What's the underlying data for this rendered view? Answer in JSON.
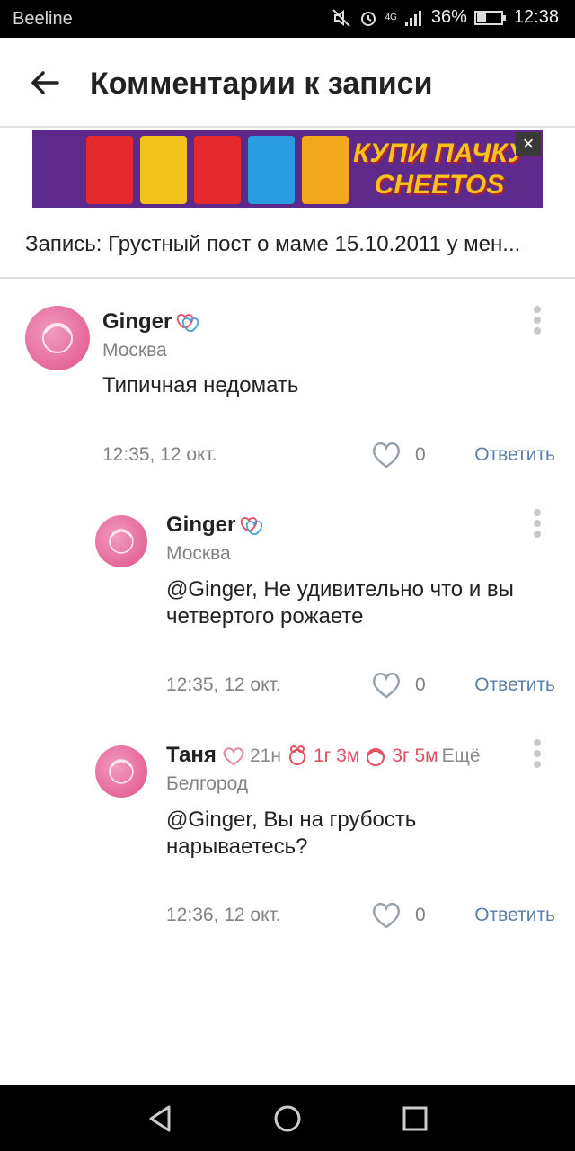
{
  "status": {
    "carrier": "Beeline",
    "network": "4G",
    "battery": "36%",
    "time": "12:38"
  },
  "header": {
    "title": "Комментарии к записи"
  },
  "ad": {
    "text_line1": "КУПИ ПАЧКУ",
    "text_line2": "CHEETOS",
    "close_label": "×"
  },
  "post": {
    "title": "Запись: Грустный пост о маме 15.10.2011 у мен..."
  },
  "comments": [
    {
      "name": "Ginger",
      "city": "Москва",
      "text": "Типичная недомать",
      "time": "12:35, 12 окт.",
      "likes": "0",
      "reply": "Ответить"
    },
    {
      "name": "Ginger",
      "city": "Москва",
      "text": "@Ginger, Не удивительно что и вы четвертого рожаете",
      "time": "12:35, 12 окт.",
      "likes": "0",
      "reply": "Ответить"
    },
    {
      "name": "Таня",
      "city": "Белгород",
      "badge1": "21н",
      "badge2": "1г 3м",
      "badge3": "3г 5м",
      "badge_more": "Ещё",
      "text": "@Ginger, Вы на грубость нарываетесь?",
      "time": "12:36, 12 окт.",
      "likes": "0",
      "reply": "Ответить"
    }
  ],
  "colors": {
    "accent": "#5b7fa6",
    "badge_pink": "#e05062",
    "avatar_pink": "#e56799"
  }
}
